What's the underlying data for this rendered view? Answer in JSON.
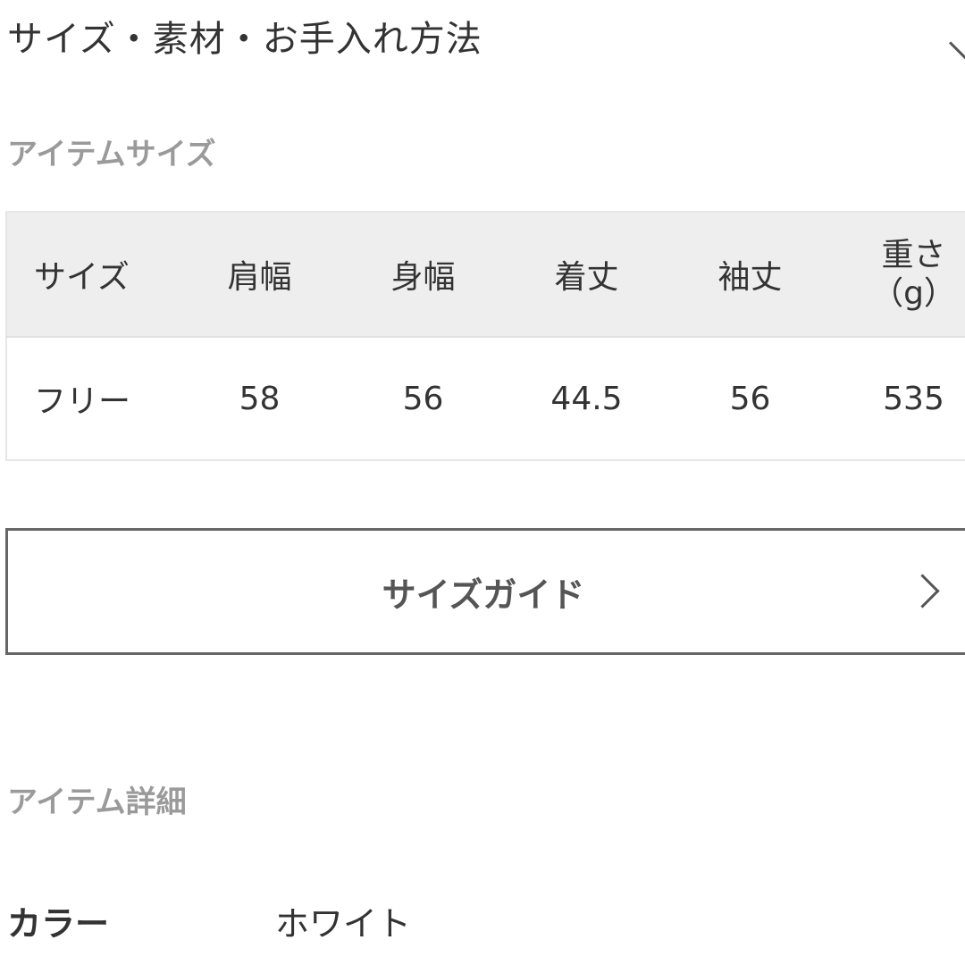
{
  "accordion": {
    "title": "サイズ・素材・お手入れ方法",
    "icon": "chevron-down-icon"
  },
  "item_size": {
    "label": "アイテムサイズ",
    "columns": [
      "サイズ",
      "肩幅",
      "身幅",
      "着丈",
      "袖丈",
      [
        "重さ",
        "（g）"
      ]
    ],
    "rows": [
      [
        "フリー",
        "58",
        "56",
        "44.5",
        "56",
        "535"
      ]
    ]
  },
  "size_guide": {
    "label": "サイズガイド",
    "icon": "chevron-right-icon"
  },
  "item_detail": {
    "label": "アイテム詳細",
    "rows": [
      {
        "key": "カラー",
        "value": "ホワイト"
      }
    ]
  },
  "colors": {
    "text": "#333333",
    "muted_label": "#9a9a9a",
    "table_header_bg": "#eeeeee",
    "button_border": "#666666"
  }
}
